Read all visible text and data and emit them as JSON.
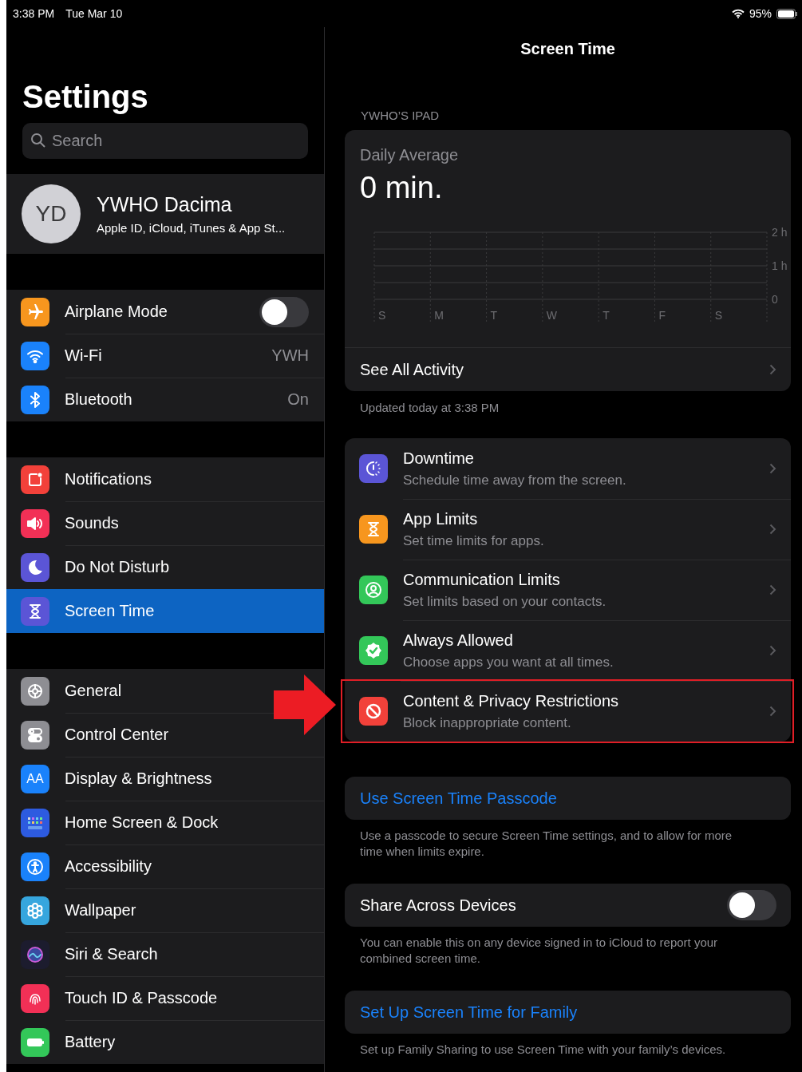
{
  "status_bar": {
    "time": "3:38 PM",
    "date": "Tue Mar 10",
    "battery": "95%"
  },
  "sidebar": {
    "title": "Settings",
    "search": {
      "placeholder": "Search"
    },
    "profile": {
      "initials": "YD",
      "name": "YWHO Dacima",
      "subtitle": "Apple ID, iCloud, iTunes & App St..."
    },
    "groups": [
      {
        "items": [
          {
            "label": "Airplane Mode",
            "kind": "toggle",
            "on": false,
            "selected": false,
            "color": "#f7961e"
          },
          {
            "label": "Wi-Fi",
            "kind": "value",
            "value": "YWH",
            "selected": false,
            "color": "#1a82fb"
          },
          {
            "label": "Bluetooth",
            "kind": "value",
            "value": "On",
            "selected": false,
            "color": "#1a82fb"
          }
        ]
      },
      {
        "items": [
          {
            "label": "Notifications",
            "kind": "plain",
            "selected": false,
            "color": "#f2413a"
          },
          {
            "label": "Sounds",
            "kind": "plain",
            "selected": false,
            "color": "#f23056"
          },
          {
            "label": "Do Not Disturb",
            "kind": "plain",
            "selected": false,
            "color": "#5b55d6"
          },
          {
            "label": "Screen Time",
            "kind": "plain",
            "selected": true,
            "color": "#5b55d6"
          }
        ]
      },
      {
        "items": [
          {
            "label": "General",
            "kind": "plain",
            "selected": false,
            "color": "#8e8e93"
          },
          {
            "label": "Control Center",
            "kind": "plain",
            "selected": false,
            "color": "#8e8e93"
          },
          {
            "label": "Display & Brightness",
            "kind": "plain",
            "selected": false,
            "color": "#1a82fb",
            "icon_text": "AA"
          },
          {
            "label": "Home Screen & Dock",
            "kind": "plain",
            "selected": false,
            "color": "#2d5be0"
          },
          {
            "label": "Accessibility",
            "kind": "plain",
            "selected": false,
            "color": "#1a82fb"
          },
          {
            "label": "Wallpaper",
            "kind": "plain",
            "selected": false,
            "color": "#36a6de"
          },
          {
            "label": "Siri & Search",
            "kind": "plain",
            "selected": false,
            "color": "#1c1c2e"
          },
          {
            "label": "Touch ID & Passcode",
            "kind": "plain",
            "selected": false,
            "color": "#f23056"
          },
          {
            "label": "Battery",
            "kind": "plain",
            "selected": false,
            "color": "#33c759"
          }
        ]
      }
    ]
  },
  "detail": {
    "title": "Screen Time",
    "device_header": "YWHO’S IPAD",
    "summary": {
      "label": "Daily Average",
      "value": "0 min.",
      "chart_data": {
        "type": "bar",
        "categories": [
          "S",
          "M",
          "T",
          "W",
          "T",
          "F",
          "S"
        ],
        "values": [
          0,
          0,
          0,
          0,
          0,
          0,
          0
        ],
        "ylim": [
          0,
          2
        ],
        "yticks": [
          {
            "value": 0,
            "label": "0"
          },
          {
            "value": 1,
            "label": "1 h"
          },
          {
            "value": 2,
            "label": "2 h"
          }
        ]
      },
      "link": "See All Activity"
    },
    "updated": "Updated today at 3:38 PM",
    "options": [
      {
        "title": "Downtime",
        "subtitle": "Schedule time away from the screen.",
        "color": "#5b55d6",
        "highlighted": false
      },
      {
        "title": "App Limits",
        "subtitle": "Set time limits for apps.",
        "color": "#f7961e",
        "highlighted": false
      },
      {
        "title": "Communication Limits",
        "subtitle": "Set limits based on your contacts.",
        "color": "#33c759",
        "highlighted": false
      },
      {
        "title": "Always Allowed",
        "subtitle": "Choose apps you want at all times.",
        "color": "#33c759",
        "highlighted": false
      },
      {
        "title": "Content & Privacy Restrictions",
        "subtitle": "Block inappropriate content.",
        "color": "#f2413a",
        "highlighted": true
      }
    ],
    "passcode": {
      "link": "Use Screen Time Passcode",
      "footer": "Use a passcode to secure Screen Time settings, and to allow for more time when limits expire."
    },
    "share": {
      "label": "Share Across Devices",
      "on": false,
      "footer": "You can enable this on any device signed in to iCloud to report your combined screen time."
    },
    "family": {
      "link": "Set Up Screen Time for Family",
      "footer": "Set up Family Sharing to use Screen Time with your family’s devices."
    }
  }
}
